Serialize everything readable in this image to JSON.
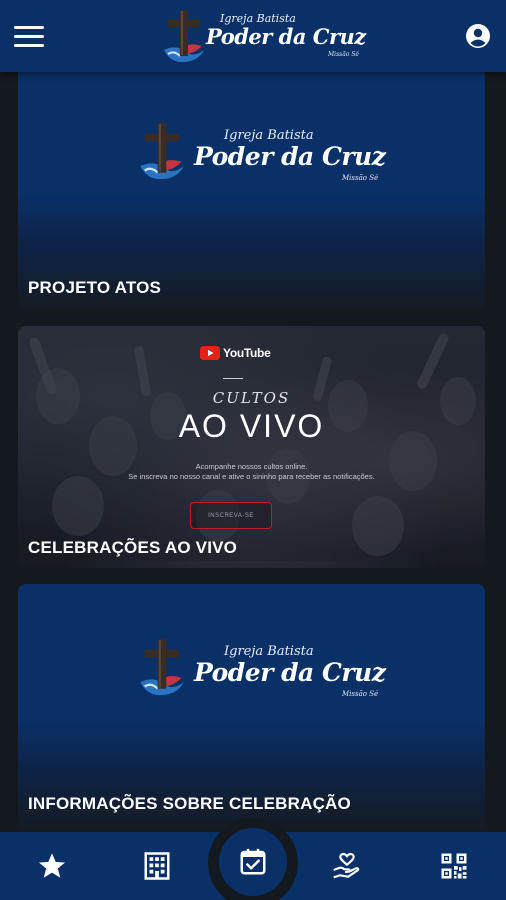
{
  "app": {
    "logo": {
      "kicker": "Igreja Batista",
      "name": "Poder da Cruz",
      "place": "Missão Sé"
    }
  },
  "cards": [
    {
      "title": "PROJETO ATOS"
    },
    {
      "title": "CELEBRAÇÕES AO VIVO",
      "banner": {
        "youtube": "YouTube",
        "kicker": "CULTOS",
        "headline": "AO VIVO",
        "line1": "Acompanhe nossos cultos online.",
        "line2": "Se inscreva no nosso canal e ative o sininho para receber as notificações.",
        "button": "INSCREVA-SE"
      }
    },
    {
      "title": "INFORMAÇÕES SOBRE CELEBRAÇÃO"
    }
  ],
  "nav": {
    "items": [
      "star-icon",
      "building-icon",
      "calendar-check-icon",
      "heart-hand-icon",
      "qr-code-icon"
    ],
    "active": "calendar-check-icon"
  },
  "colors": {
    "primary": "#0a3068",
    "background": "#14191f",
    "youtube_red": "#e62117"
  }
}
